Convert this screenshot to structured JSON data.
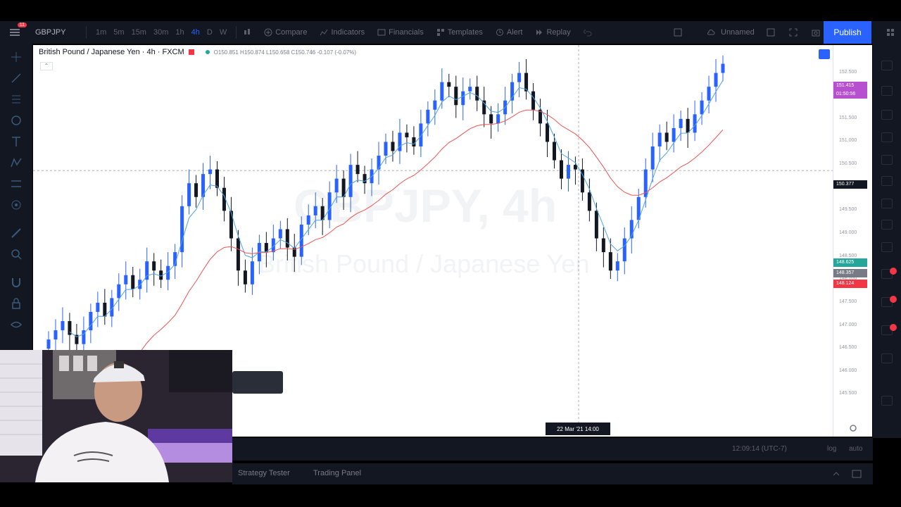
{
  "toolbar": {
    "notification_count": "11",
    "symbol": "GBPJPY",
    "timeframes": [
      "1m",
      "5m",
      "15m",
      "30m",
      "1h",
      "4h",
      "D",
      "W"
    ],
    "active_timeframe": "4h",
    "compare_label": "Compare",
    "indicators_label": "Indicators",
    "financials_label": "Financials",
    "templates_label": "Templates",
    "alert_label": "Alert",
    "replay_label": "Replay",
    "layout_name": "Unnamed",
    "publish_label": "Publish"
  },
  "chart": {
    "title": "British Pound / Japanese Yen · 4h · FXCM",
    "ohlc_text": "O150.851 H150.874 L150.658 C150.746 -0.107 (-0.07%)",
    "watermark_symbol": "GBPJPY, 4h",
    "watermark_name": "British Pound / Japanese Yen",
    "crosshair_time": "22 Mar '21  14:00",
    "crosshair_price": "150.377"
  },
  "price_axis": {
    "labels": [
      "152.500",
      "152.000",
      "151.500",
      "151.000",
      "150.500",
      "150.000",
      "149.500",
      "149.000",
      "148.500",
      "148.000",
      "147.500",
      "147.000",
      "146.500",
      "146.000",
      "145.500"
    ],
    "last_price": "151.415",
    "last_price_countdown": "01:50:56",
    "tag_ask": "148.625",
    "tag_mid": "148.357",
    "tag_bid": "148.124"
  },
  "bottom": {
    "clock": "12:09:14 (UTC-7)",
    "log_label": "log",
    "auto_label": "auto",
    "tab_strategy": "Strategy Tester",
    "tab_trading": "Trading Panel"
  },
  "colors": {
    "up": "#2962ff",
    "down": "#131722",
    "ema_fast": "#4fa3e0",
    "ema_slow": "#ef5350",
    "accent": "#2962ff"
  },
  "chart_data": {
    "type": "candlestick",
    "symbol": "GBPJPY",
    "interval": "4h",
    "ylim": [
      145.2,
      152.8
    ],
    "series": [
      {
        "name": "",
        "type": "ohlc",
        "close": [
          146.7,
          146.9,
          147.1,
          146.8,
          146.6,
          146.9,
          147.3,
          147.5,
          147.2,
          147.6,
          147.9,
          148.1,
          147.8,
          148.0,
          148.4,
          148.2,
          148.0,
          148.3,
          148.6,
          149.6,
          150.1,
          149.8,
          150.3,
          150.4,
          150.0,
          149.5,
          148.9,
          148.2,
          147.9,
          148.4,
          148.8,
          148.6,
          148.9,
          149.1,
          148.7,
          148.5,
          149.2,
          149.4,
          149.6,
          149.3,
          149.9,
          150.2,
          149.8,
          150.5,
          150.3,
          150.1,
          150.4,
          150.7,
          151.0,
          150.8,
          151.2,
          151.1,
          150.9,
          151.4,
          151.7,
          151.9,
          152.3,
          152.2,
          151.8,
          152.1,
          152.2,
          151.9,
          151.6,
          151.4,
          151.6,
          151.9,
          152.3,
          152.5,
          152.1,
          151.7,
          151.4,
          151.0,
          150.6,
          150.2,
          150.5,
          150.4,
          149.9,
          149.5,
          148.9,
          148.6,
          148.2,
          148.4,
          148.9,
          149.3,
          149.8,
          150.4,
          150.9,
          151.2,
          151.0,
          151.3,
          151.5,
          151.2,
          151.6,
          151.9,
          152.2,
          152.5,
          152.7
        ]
      }
    ]
  }
}
